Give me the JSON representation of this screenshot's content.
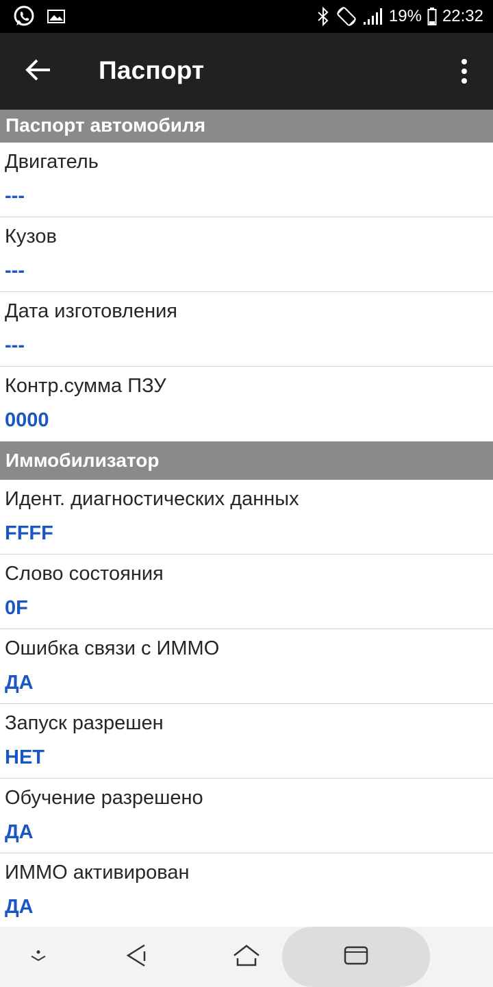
{
  "status_bar": {
    "battery": "19%",
    "time": "22:32",
    "icons": [
      "whatsapp-icon",
      "image-icon",
      "bluetooth-icon",
      "rotate-icon",
      "signal-icon",
      "battery-icon"
    ]
  },
  "app_bar": {
    "title": "Паспорт",
    "back_icon": "arrow-left-icon",
    "menu_icon": "more-vert-icon"
  },
  "sections": [
    {
      "title": "Паспорт автомобиля",
      "rows": [
        {
          "label": "Двигатель",
          "value": "---"
        },
        {
          "label": "Кузов",
          "value": "---"
        },
        {
          "label": "Дата изготовления",
          "value": "---"
        },
        {
          "label": "Контр.сумма ПЗУ",
          "value": "0000"
        }
      ]
    },
    {
      "title": "Иммобилизатор",
      "rows": [
        {
          "label": "Идент. диагностических данных",
          "value": "FFFF"
        },
        {
          "label": "Слово состояния",
          "value": "0F"
        },
        {
          "label": "Ошибка связи с ИММО",
          "value": "ДА"
        },
        {
          "label": "Запуск разрешен",
          "value": "НЕТ"
        },
        {
          "label": "Обучение разрешено",
          "value": "ДА"
        },
        {
          "label": "ИММО активирован",
          "value": "ДА"
        }
      ]
    }
  ],
  "nav_bar": {
    "icons": [
      "chevron-down-icon",
      "nav-back-icon",
      "home-icon",
      "recents-icon"
    ]
  },
  "colors": {
    "value_text": "#1a56c4",
    "section_header_bg": "#8a8a8a",
    "app_bar_bg": "#212121"
  }
}
